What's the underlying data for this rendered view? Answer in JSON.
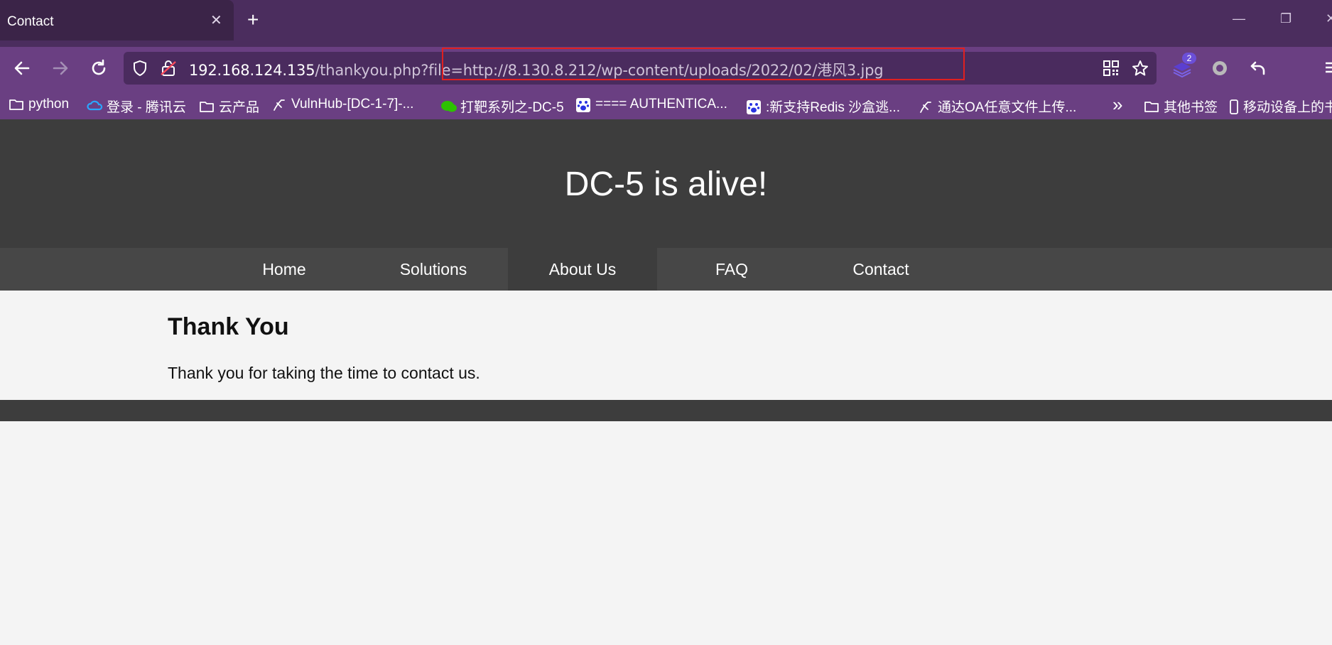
{
  "browser": {
    "tab": {
      "title": "Contact",
      "close": "✕"
    },
    "new_tab": "+",
    "window_controls": {
      "minimize": "—",
      "restore": "❐",
      "close": "✕"
    },
    "url": {
      "host": "192.168.124.135",
      "path": "/thankyou.php?file=http://8.130.8.212/wp-content/uploads/2022/02/港风3.jpg"
    },
    "extension_badge": "2",
    "bookmarks": [
      {
        "label": "python",
        "icon": "folder-icon"
      },
      {
        "label": "登录 - 腾讯云",
        "icon": "tencent-cloud-icon"
      },
      {
        "label": "云产品",
        "icon": "folder-icon"
      },
      {
        "label": "VulnHub-[DC-1-7]-...",
        "icon": "sword-icon"
      },
      {
        "label": "打靶系列之-DC-5",
        "icon": "wechat-icon"
      },
      {
        "label": "==== AUTHENTICA...",
        "icon": "baidu-icon"
      },
      {
        "label": ":新支持Redis 沙盒逃...",
        "icon": "baidu-icon"
      },
      {
        "label": "通达OA任意文件上传...",
        "icon": "sword-icon"
      },
      {
        "label": "其他书签",
        "icon": "folder-icon"
      },
      {
        "label": "移动设备上的书",
        "icon": "mobile-icon"
      }
    ],
    "bookmarks_overflow": "»"
  },
  "page": {
    "site_title": "DC-5 is alive!",
    "nav": [
      {
        "label": "Home"
      },
      {
        "label": "Solutions"
      },
      {
        "label": "About Us"
      },
      {
        "label": "FAQ"
      },
      {
        "label": "Contact"
      }
    ],
    "heading": "Thank You",
    "message": "Thank you for taking the time to contact us."
  },
  "colors": {
    "tabstrip": "#4b2d5e",
    "toolbar": "#6a3f82",
    "header_bg": "#3d3d3d",
    "nav_bg": "#474747",
    "highlight": "#e02020"
  }
}
